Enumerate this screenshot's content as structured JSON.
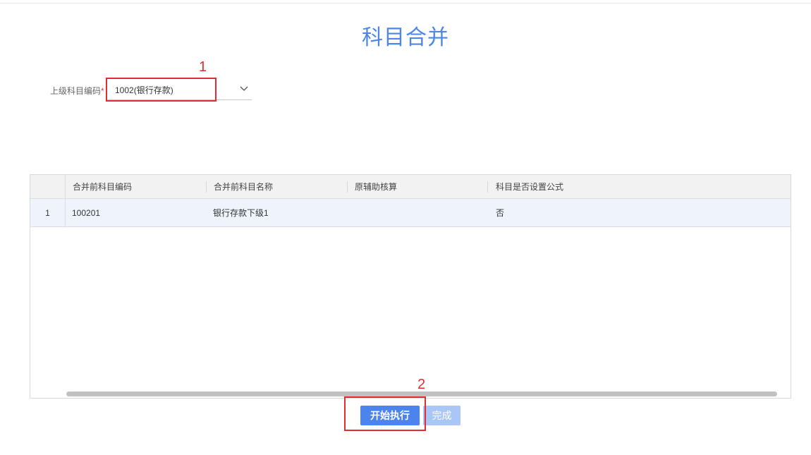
{
  "page": {
    "title": "科目合并"
  },
  "form": {
    "parent_code_label": "上级科目编码",
    "required_mark": "*",
    "parent_code_value": "1002(银行存款)"
  },
  "annotations": {
    "step1": "1",
    "step2": "2"
  },
  "table": {
    "columns": [
      "合并前科目编码",
      "合并前科目名称",
      "原辅助核算",
      "科目是否设置公式"
    ],
    "rows": [
      {
        "index": "1",
        "code": "100201",
        "name": "银行存款下级1",
        "aux": "",
        "formula": "否"
      }
    ]
  },
  "actions": {
    "start_label": "开始执行",
    "done_label": "完成"
  },
  "colors": {
    "accent": "#4a84ec",
    "title": "#4d86e6",
    "annotation": "#e02e2e",
    "disabled": "#a9c6f6"
  }
}
